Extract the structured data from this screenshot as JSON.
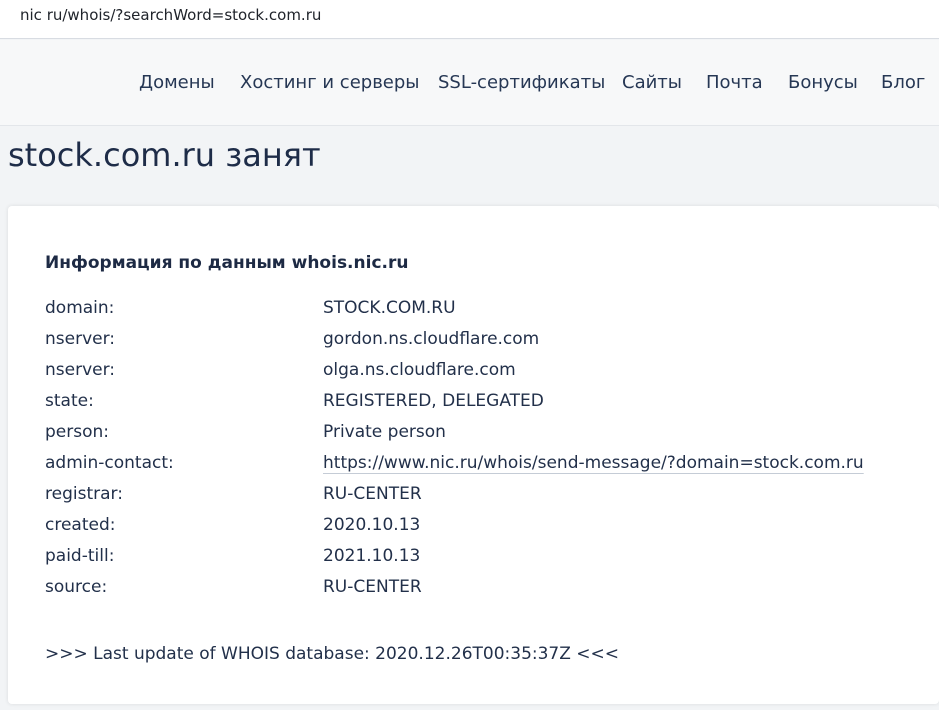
{
  "urlbar": {
    "url": "nic ru/whois/?searchWord=stock.com.ru"
  },
  "nav": {
    "items": [
      "Домены",
      "Хостинг и серверы",
      "SSL-сертификаты",
      "Сайты",
      "Почта",
      "Бонусы",
      "Блог"
    ]
  },
  "page": {
    "title": "stock.com.ru занят"
  },
  "whois": {
    "heading": "Информация по данным whois.nic.ru",
    "rows": [
      {
        "key": "domain:",
        "value": "STOCK.COM.RU"
      },
      {
        "key": "nserver:",
        "value": "gordon.ns.cloudflare.com"
      },
      {
        "key": "nserver:",
        "value": "olga.ns.cloudflare.com"
      },
      {
        "key": "state:",
        "value": "REGISTERED, DELEGATED"
      },
      {
        "key": "person:",
        "value": "Private person"
      },
      {
        "key": "admin-contact:",
        "value": "https://www.nic.ru/whois/send-message/?domain=stock.com.ru"
      },
      {
        "key": "registrar:",
        "value": "RU-CENTER"
      },
      {
        "key": "created:",
        "value": "2020.10.13"
      },
      {
        "key": "paid-till:",
        "value": "2021.10.13"
      },
      {
        "key": "source:",
        "value": "RU-CENTER"
      }
    ],
    "last_update": ">>> Last update of WHOIS database: 2020.12.26T00:35:37Z <<<"
  }
}
